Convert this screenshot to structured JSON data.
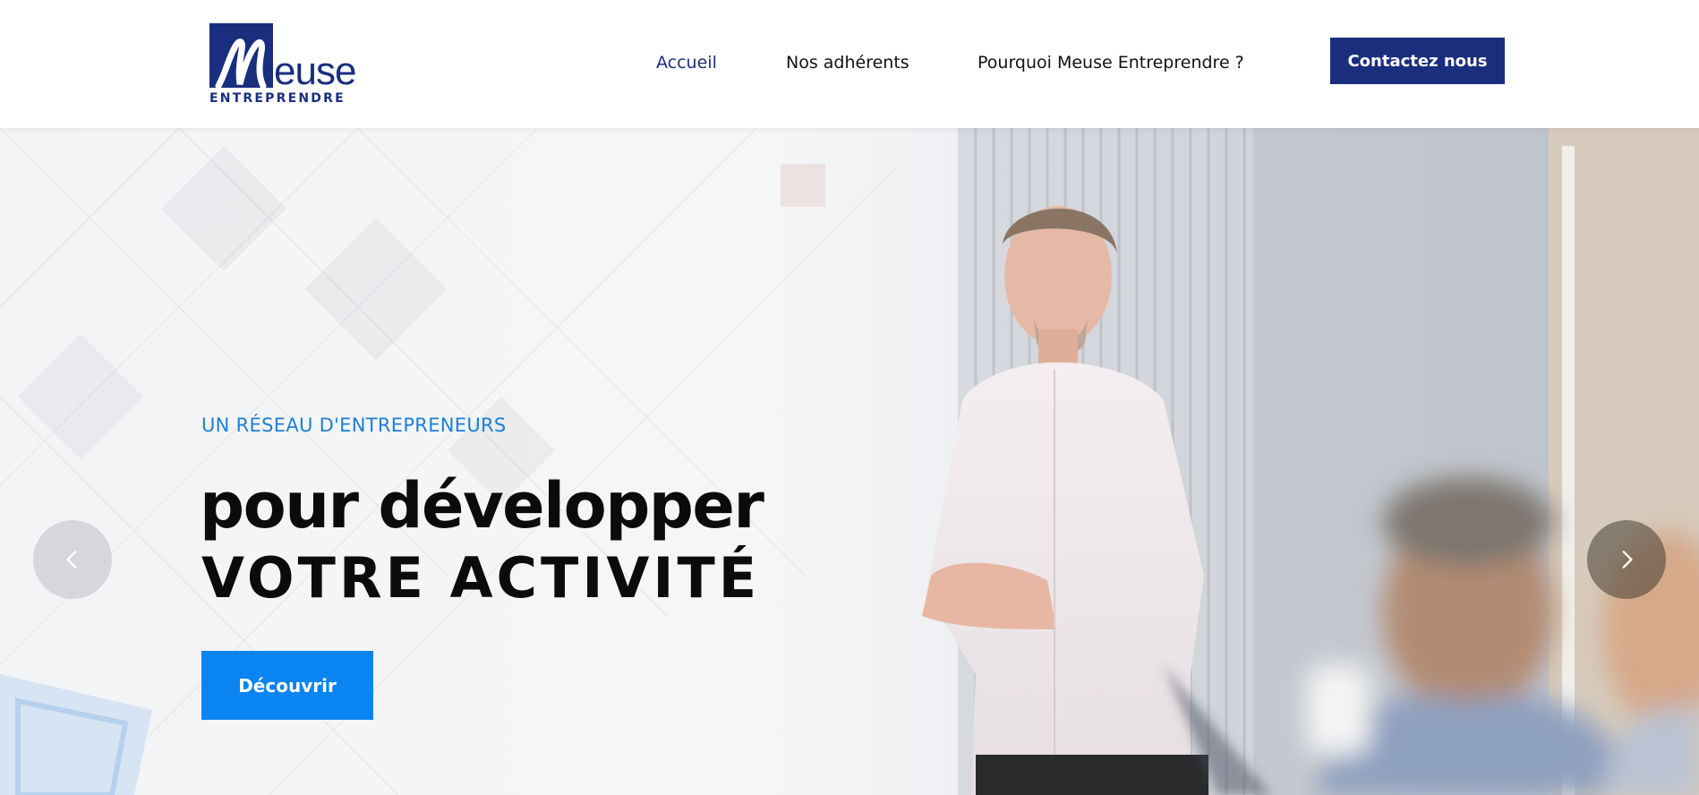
{
  "brand": {
    "logo_initial": "M",
    "logo_word": "euse",
    "logo_subtitle": "ENTREPRENDRE",
    "primary_color": "#1a2e7e",
    "accent_color": "#0a84f0"
  },
  "nav": {
    "items": [
      {
        "label": "Accueil",
        "active": true
      },
      {
        "label": "Nos adhérents",
        "active": false
      },
      {
        "label": "Pourquoi Meuse Entreprendre ?",
        "active": false
      }
    ],
    "contact_label": "Contactez nous"
  },
  "hero": {
    "kicker": "UN RÉSEAU D'ENTREPRENEURS",
    "headline_line1": "pour développer",
    "headline_line2": "VOTRE ACTIVITÉ",
    "cta_label": "Découvrir",
    "prev_icon": "chevron-left-icon",
    "next_icon": "chevron-right-icon"
  }
}
